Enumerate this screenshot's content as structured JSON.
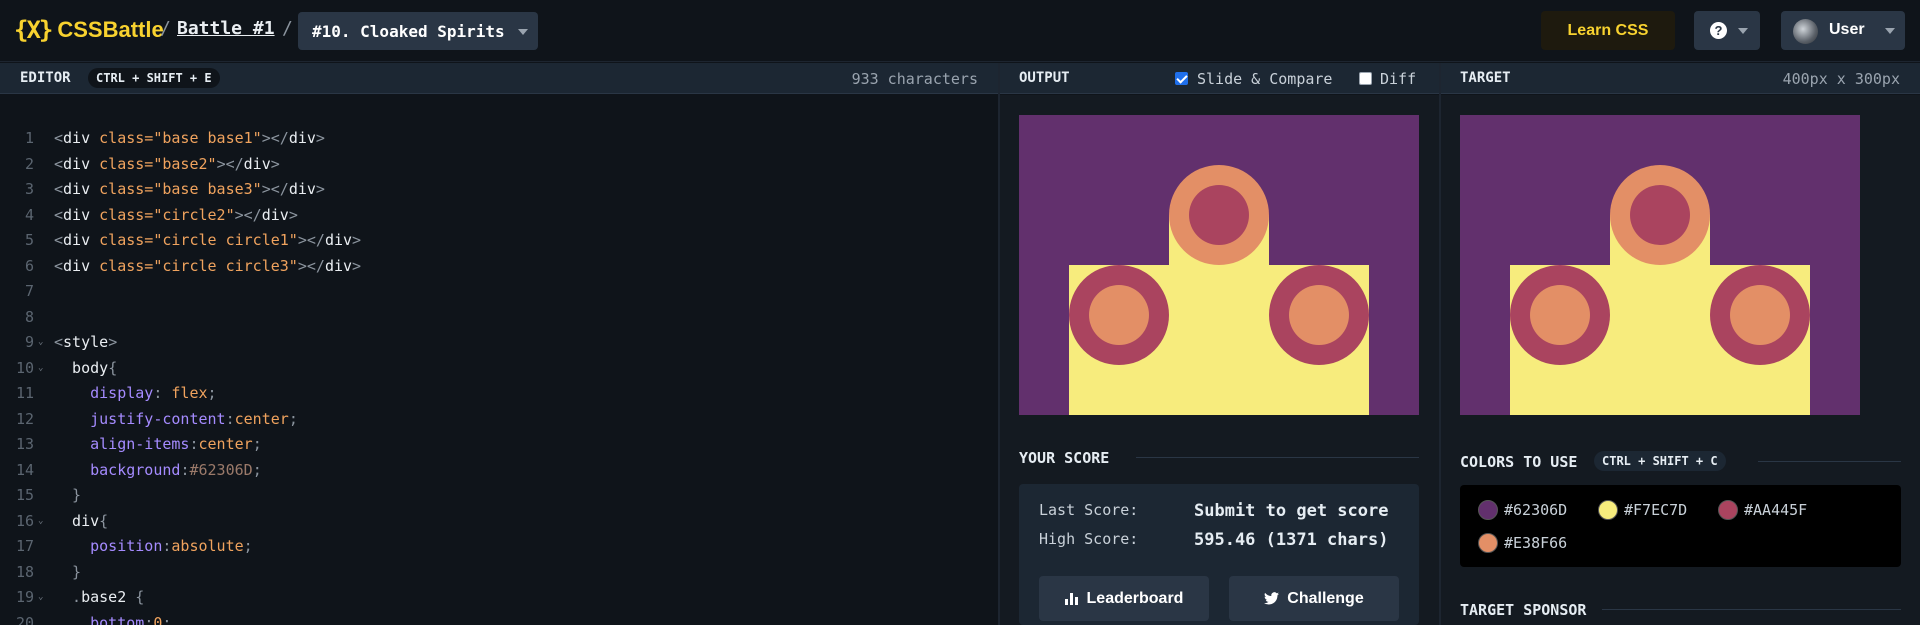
{
  "header": {
    "logo_mark": "{X}",
    "logo_text": "CSSBattle",
    "sep": "/",
    "battle": "Battle #1",
    "target_select": "#10. Cloaked Spirits",
    "learn_label": "Learn CSS",
    "help_label": "?",
    "user_label": "User"
  },
  "editor": {
    "title": "EDITOR",
    "shortcut": "CTRL + SHIFT + E",
    "char_count": "933 characters",
    "lines": [
      {
        "n": "1",
        "parts": [
          [
            "c-punc",
            "<"
          ],
          [
            "c-tag",
            "div "
          ],
          [
            "c-attr",
            "class="
          ],
          [
            "c-str",
            "\"base base1\""
          ],
          [
            "c-punc",
            "></"
          ],
          [
            "c-tag",
            "div"
          ],
          [
            "c-punc",
            ">"
          ]
        ]
      },
      {
        "n": "2",
        "parts": [
          [
            "c-punc",
            "<"
          ],
          [
            "c-tag",
            "div "
          ],
          [
            "c-attr",
            "class="
          ],
          [
            "c-str",
            "\"base2\""
          ],
          [
            "c-punc",
            "></"
          ],
          [
            "c-tag",
            "div"
          ],
          [
            "c-punc",
            ">"
          ]
        ]
      },
      {
        "n": "3",
        "parts": [
          [
            "c-punc",
            "<"
          ],
          [
            "c-tag",
            "div "
          ],
          [
            "c-attr",
            "class="
          ],
          [
            "c-str",
            "\"base base3\""
          ],
          [
            "c-punc",
            "></"
          ],
          [
            "c-tag",
            "div"
          ],
          [
            "c-punc",
            ">"
          ]
        ]
      },
      {
        "n": "4",
        "parts": [
          [
            "c-punc",
            "<"
          ],
          [
            "c-tag",
            "div "
          ],
          [
            "c-attr",
            "class="
          ],
          [
            "c-str",
            "\"circle2\""
          ],
          [
            "c-punc",
            "></"
          ],
          [
            "c-tag",
            "div"
          ],
          [
            "c-punc",
            ">"
          ]
        ]
      },
      {
        "n": "5",
        "parts": [
          [
            "c-punc",
            "<"
          ],
          [
            "c-tag",
            "div "
          ],
          [
            "c-attr",
            "class="
          ],
          [
            "c-str",
            "\"circle circle1\""
          ],
          [
            "c-punc",
            "></"
          ],
          [
            "c-tag",
            "div"
          ],
          [
            "c-punc",
            ">"
          ]
        ]
      },
      {
        "n": "6",
        "parts": [
          [
            "c-punc",
            "<"
          ],
          [
            "c-tag",
            "div "
          ],
          [
            "c-attr",
            "class="
          ],
          [
            "c-str",
            "\"circle circle3\""
          ],
          [
            "c-punc",
            "></"
          ],
          [
            "c-tag",
            "div"
          ],
          [
            "c-punc",
            ">"
          ]
        ]
      },
      {
        "n": "7",
        "parts": []
      },
      {
        "n": "8",
        "parts": []
      },
      {
        "n": "9",
        "fold": true,
        "parts": [
          [
            "c-punc",
            "<"
          ],
          [
            "c-tag",
            "style"
          ],
          [
            "c-punc",
            ">"
          ]
        ]
      },
      {
        "n": "10",
        "fold": true,
        "parts": [
          [
            "c-sel",
            "  body"
          ],
          [
            "c-punc",
            "{"
          ]
        ]
      },
      {
        "n": "11",
        "parts": [
          [
            "c-prop",
            "    display"
          ],
          [
            "c-punc",
            ": "
          ],
          [
            "c-val",
            "flex"
          ],
          [
            "c-punc",
            ";"
          ]
        ]
      },
      {
        "n": "12",
        "parts": [
          [
            "c-prop",
            "    justify-content"
          ],
          [
            "c-punc",
            ":"
          ],
          [
            "c-val",
            "center"
          ],
          [
            "c-punc",
            ";"
          ]
        ]
      },
      {
        "n": "13",
        "parts": [
          [
            "c-prop",
            "    align-items"
          ],
          [
            "c-punc",
            ":"
          ],
          [
            "c-val",
            "center"
          ],
          [
            "c-punc",
            ";"
          ]
        ]
      },
      {
        "n": "14",
        "parts": [
          [
            "c-prop",
            "    background"
          ],
          [
            "c-punc",
            ":"
          ],
          [
            "c-hex",
            "#62306D"
          ],
          [
            "c-punc",
            ";"
          ]
        ]
      },
      {
        "n": "15",
        "parts": [
          [
            "c-punc",
            "  }"
          ]
        ]
      },
      {
        "n": "16",
        "fold": true,
        "parts": [
          [
            "c-sel",
            "  div"
          ],
          [
            "c-punc",
            "{"
          ]
        ]
      },
      {
        "n": "17",
        "parts": [
          [
            "c-prop",
            "    position"
          ],
          [
            "c-punc",
            ":"
          ],
          [
            "c-val",
            "absolute"
          ],
          [
            "c-punc",
            ";"
          ]
        ]
      },
      {
        "n": "18",
        "parts": [
          [
            "c-punc",
            "  }"
          ]
        ]
      },
      {
        "n": "19",
        "fold": true,
        "parts": [
          [
            "c-punc",
            "  ."
          ],
          [
            "c-sel",
            "base2 "
          ],
          [
            "c-punc",
            "{"
          ]
        ]
      },
      {
        "n": "20",
        "parts": [
          [
            "c-prop",
            "    bottom"
          ],
          [
            "c-punc",
            ":"
          ],
          [
            "c-val",
            "0"
          ],
          [
            "c-punc",
            ";"
          ]
        ]
      }
    ]
  },
  "output": {
    "title": "OUTPUT",
    "slide_compare_label": "Slide & Compare",
    "slide_compare_checked": true,
    "diff_label": "Diff",
    "diff_checked": false
  },
  "score": {
    "title": "YOUR SCORE",
    "last_label": "Last Score:",
    "last_value": "Submit to get score",
    "high_label": "High Score:",
    "high_value": "595.46 (1371 chars)",
    "leaderboard_label": "Leaderboard",
    "challenge_label": "Challenge"
  },
  "target": {
    "title": "TARGET",
    "dims": "400px x 300px",
    "colors_title": "COLORS TO USE",
    "colors_shortcut": "CTRL + SHIFT + C",
    "colors": [
      "#62306D",
      "#F7EC7D",
      "#AA445F",
      "#E38F66"
    ],
    "sponsor_title": "TARGET SPONSOR"
  }
}
